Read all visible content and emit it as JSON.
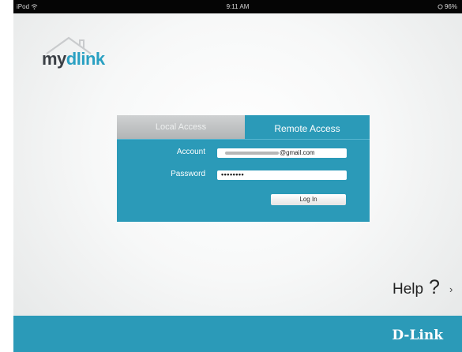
{
  "status_bar": {
    "device": "iPod",
    "time": "9:11 AM",
    "battery": "96%"
  },
  "logo": {
    "text_plain": "my",
    "text_accent": "dlink",
    "accent_color": "#2aa0c2"
  },
  "login": {
    "tabs": [
      {
        "label": "Local Access",
        "active": false
      },
      {
        "label": "Remote Access",
        "active": true
      }
    ],
    "account_label": "Account",
    "account_value": "@gmail.com",
    "password_label": "Password",
    "password_value": "••••••••",
    "login_button": "Log In"
  },
  "help": {
    "label": "Help",
    "icon_glyph": "?",
    "chevron": "›"
  },
  "footer": {
    "brand": "D-Link",
    "color": "#2b9ab8"
  }
}
